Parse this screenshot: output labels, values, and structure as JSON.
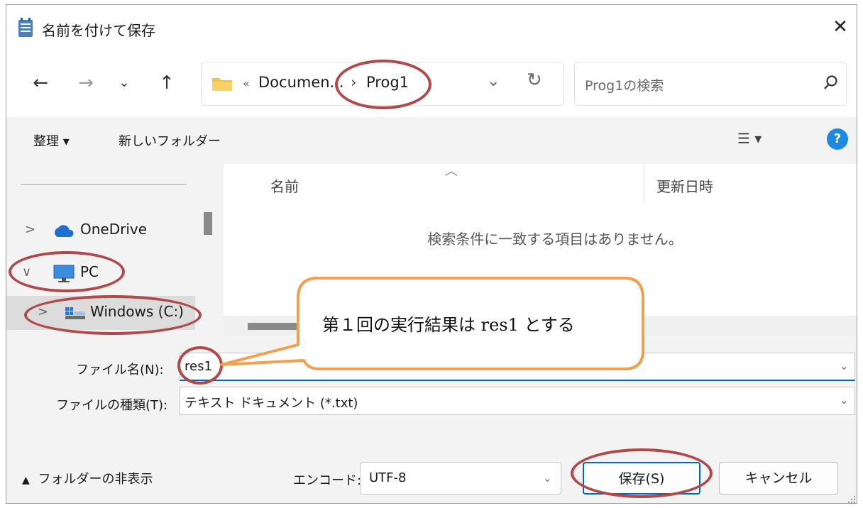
{
  "title": "名前を付けて保存",
  "nav": {
    "breadcrumb_overflow": "«",
    "breadcrumb_1": "Documen...",
    "breadcrumb_sep": "›",
    "breadcrumb_2": "Prog1",
    "search_placeholder": "Prog1の検索"
  },
  "toolbar": {
    "organize": "整理 ▾",
    "new_folder": "新しいフォルダー",
    "view_menu": "☰ ▾",
    "help": "?"
  },
  "sidebar": {
    "items": [
      {
        "label": "OneDrive",
        "chevron": ">"
      },
      {
        "label": "PC",
        "chevron": "∨"
      },
      {
        "label": "Windows (C:)",
        "chevron": ">"
      }
    ]
  },
  "file_list": {
    "col_name": "名前",
    "col_modified": "更新日時",
    "empty_message": "検索条件に一致する項目はありません。"
  },
  "form": {
    "filename_label": "ファイル名(N):",
    "filename_value": "res1",
    "filetype_label": "ファイルの種類(T):",
    "filetype_value": "テキスト ドキュメント (*.txt)"
  },
  "footer": {
    "hide_folders": "フォルダーの非表示",
    "encoding_label": "エンコード:",
    "encoding_value": "UTF-8",
    "save": "保存(S)",
    "cancel": "キャンセル"
  },
  "annotation": {
    "callout_text": "第１回の実行結果は res1 とする"
  },
  "colors": {
    "accent": "#0067c0",
    "annotation_ring": "#b04a4a",
    "callout_border": "#f0a050",
    "help_blue": "#1e88e5"
  }
}
